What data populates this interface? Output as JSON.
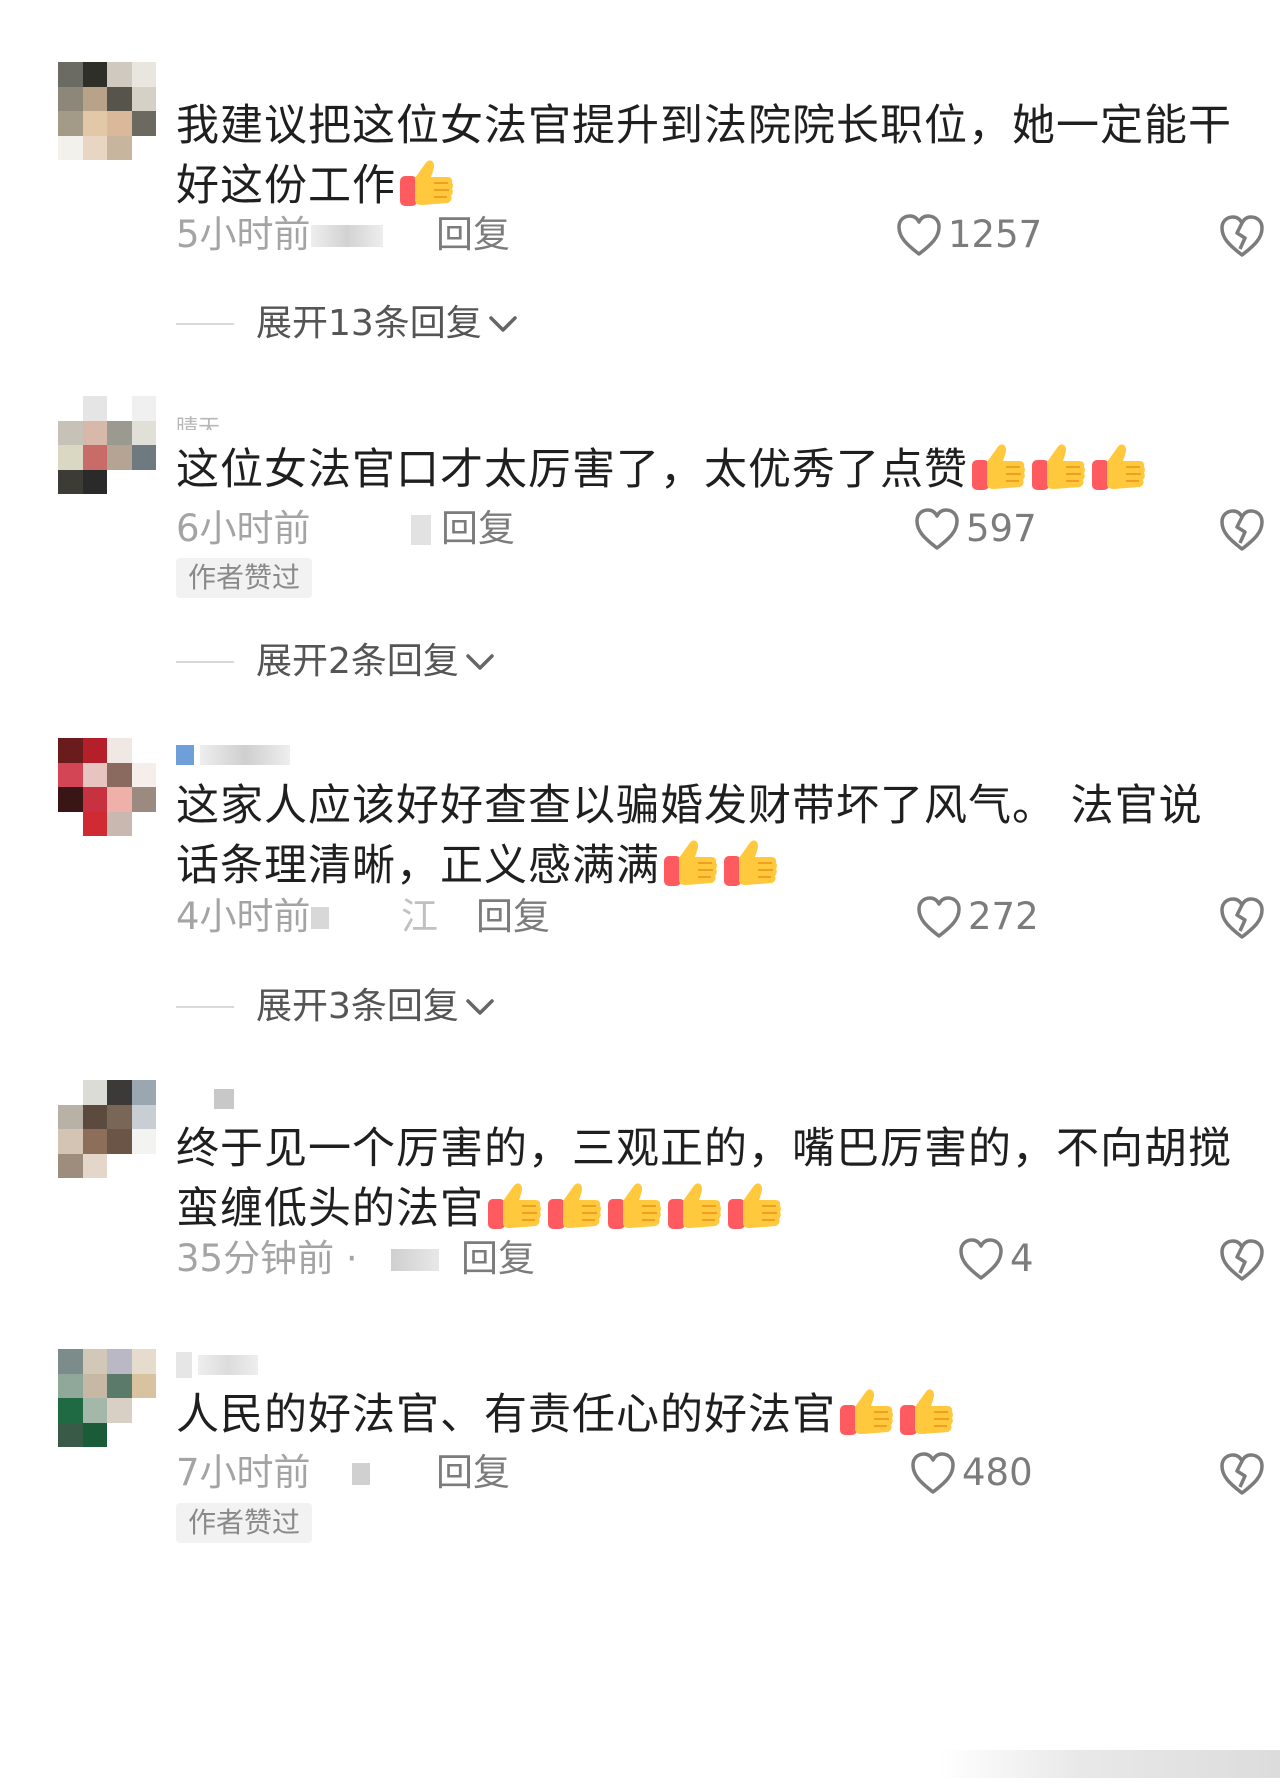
{
  "colors": {
    "heart": "#7c7c7c",
    "emoji_thumb": "#ffc83d",
    "emoji_cuff": "#ff5a5f",
    "tag_bg": "#f2f2f2"
  },
  "icons": {
    "like": "heart-outline-icon",
    "dislike": "broken-heart-icon",
    "expand": "chevron-down-icon",
    "emoji": "thumbs-up-emoji"
  },
  "comments": [
    {
      "text": "我建议把这位女法官提升到法院院长职位，她一定能干好这份工作",
      "emoji_count": 1,
      "time": "5小时前",
      "reply": "回复",
      "likes": "1257",
      "expand": "展开13条回复"
    },
    {
      "username_partial": "晴天",
      "text": "这位女法官口才太厉害了，太优秀了点赞",
      "emoji_count": 3,
      "time": "6小时前",
      "reply": "回复",
      "likes": "597",
      "author_tag": "作者赞过",
      "expand": "展开2条回复"
    },
    {
      "text": "这家人应该好好查查以骗婚发财带坏了风气。 法官说话条理清晰，正义感满满",
      "emoji_count": 2,
      "time": "4小时前",
      "location_partial": "江",
      "reply": "回复",
      "likes": "272",
      "expand": "展开3条回复"
    },
    {
      "text": "终于见一个厉害的，三观正的，嘴巴厉害的，不向胡搅蛮缠低头的法官",
      "emoji_count": 5,
      "time": "35分钟前 ·",
      "reply": "回复",
      "likes": "4"
    },
    {
      "text": "人民的好法官、有责任心的好法官",
      "emoji_count": 2,
      "time": "7小时前",
      "reply": "回复",
      "likes": "480",
      "author_tag": "作者赞过"
    }
  ]
}
